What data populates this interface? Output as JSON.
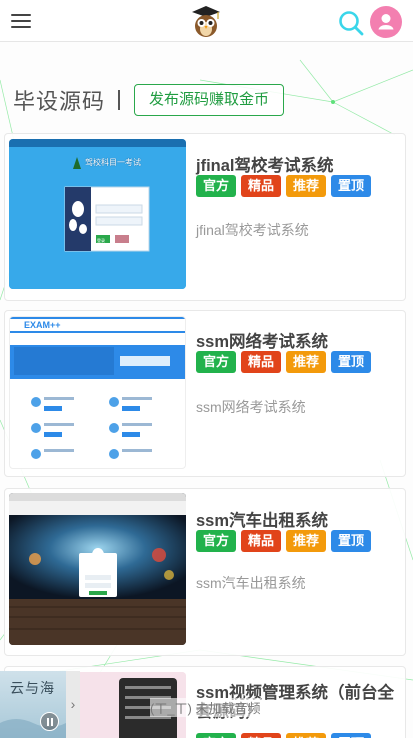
{
  "header": {
    "menu_icon": "hamburger-menu-icon",
    "logo_icon": "owl-graduate-logo-icon",
    "search_icon": "search-icon",
    "user_icon": "user-avatar-icon",
    "colors": {
      "search": "#3ad6ea",
      "user": "#f37fb0"
    }
  },
  "section": {
    "title": "毕设源码",
    "publish_label": "发布源码赚取金币"
  },
  "items": [
    {
      "title": "jfinal驾校考试系统",
      "tags": [
        "官方",
        "精品",
        "推荐",
        "置顶"
      ],
      "desc": "jfinal驾校考试系统",
      "thumb_text": "驾校科目一考试",
      "thumb_button": "登录"
    },
    {
      "title": "ssm网络考试系统",
      "tags": [
        "官方",
        "精品",
        "推荐",
        "置顶"
      ],
      "desc": "ssm网络考试系统",
      "thumb_text": "EXAM++"
    },
    {
      "title": "ssm汽车出租系统",
      "tags": [
        "官方",
        "精品",
        "推荐",
        "置顶"
      ],
      "desc": "ssm汽车出租系统"
    },
    {
      "title": "ssm视频管理系统（前台全套源码）",
      "tags": [
        "官方",
        "精品",
        "推荐",
        "置顶"
      ]
    }
  ],
  "player": {
    "cover_text": "云与海",
    "status": "(ㄒ_ㄒ) 未加载音频"
  },
  "colors": {
    "tag_official": "#22b24c",
    "tag_premium": "#e1441a",
    "tag_recommend": "#f39a0b",
    "tag_top": "#2d8ae8",
    "accent_green": "#1f9c40"
  }
}
